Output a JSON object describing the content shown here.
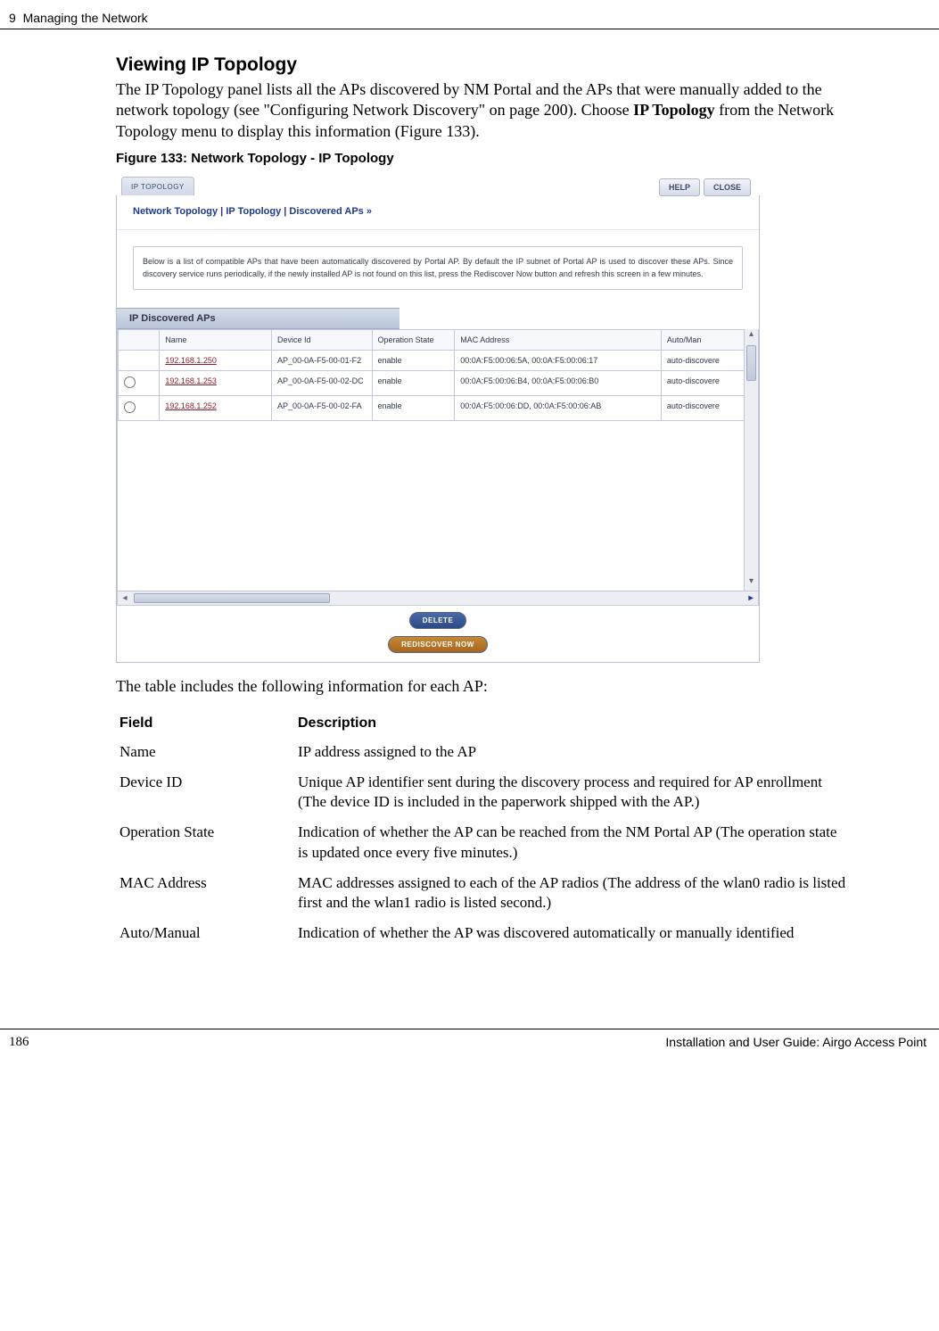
{
  "header": {
    "chapter_no": "9",
    "chapter_title": "Managing the Network"
  },
  "section": {
    "title": "Viewing IP Topology",
    "para1_a": "The IP Topology panel lists all the APs discovered by NM Portal and the APs that were manually added to the network topology (see \"Configuring Network Discovery\" on page 200). Choose ",
    "para1_bold": "IP Topology",
    "para1_b": " from the Network Topology menu to display this information (Figure 133).",
    "fig_caption": "Figure 133:    Network Topology - IP Topology",
    "para2": "The table includes the following information for each AP:"
  },
  "screenshot": {
    "tab_label": "IP TOPOLOGY",
    "btn_help": "HELP",
    "btn_close": "CLOSE",
    "breadcrumb": "Network Topology | IP Topology | Discovered APs  »",
    "help_text": "Below is a list of compatible APs that have been automatically discovered by Portal AP. By default the IP subnet of Portal AP is used to discover these APs. Since discovery service runs periodically, if the newly installed AP is not found on this list, press the Rediscover Now button and refresh this screen in a few minutes.",
    "section_bar": "IP Discovered APs",
    "columns": {
      "c0": "",
      "c1": "Name",
      "c2": "Device Id",
      "c3": "Operation State",
      "c4": "MAC Address",
      "c5": "Auto/Man"
    },
    "rows": [
      {
        "sel": "",
        "name": "192.168.1.250",
        "devid": "AP_00-0A-F5-00-01-F2",
        "op": "enable",
        "mac": "00:0A:F5:00:06:5A, 00:0A:F5:00:06:17",
        "auto": "auto-discovere"
      },
      {
        "sel": "radio",
        "name": "192.168.1.253",
        "devid": "AP_00-0A-F5-00-02-DC",
        "op": "enable",
        "mac": "00:0A:F5:00:06:B4, 00:0A:F5:00:06:B0",
        "auto": "auto-discovere"
      },
      {
        "sel": "radio",
        "name": "192.168.1.252",
        "devid": "AP_00-0A-F5-00-02-FA",
        "op": "enable",
        "mac": "00:0A:F5:00:06:DD, 00:0A:F5:00:06:AB",
        "auto": "auto-discovere"
      }
    ],
    "btn_delete": "DELETE",
    "btn_rediscover": "REDISCOVER NOW"
  },
  "fieldDesc": {
    "h1": "Field",
    "h2": "Description",
    "rows": [
      {
        "f": "Name",
        "d": "IP address assigned to the AP"
      },
      {
        "f": "Device ID",
        "d": "Unique AP identifier sent during the discovery process and required for AP enrollment (The device ID is included in the paperwork shipped with the AP.)"
      },
      {
        "f": "Operation State",
        "d": "Indication of whether the AP can be reached from the NM Portal AP (The operation state is updated once every five minutes.)"
      },
      {
        "f": "MAC Address",
        "d": "MAC addresses assigned to each of the AP radios (The address of the wlan0 radio is listed first and the wlan1 radio is listed second.)"
      },
      {
        "f": "Auto/Manual",
        "d": "Indication of whether the AP was discovered automatically or manually identified"
      }
    ]
  },
  "footer": {
    "page_no": "186",
    "guide": "Installation and User Guide: Airgo Access Point"
  }
}
